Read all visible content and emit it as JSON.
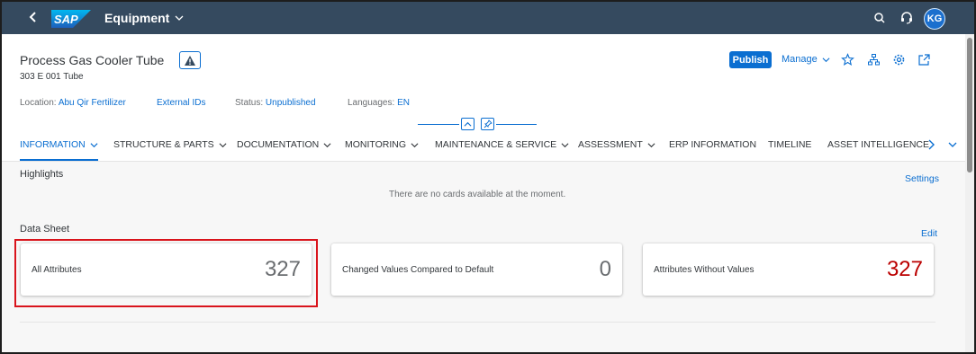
{
  "shell": {
    "app_title": "Equipment",
    "user_initials": "KG",
    "icons": [
      "back-icon",
      "sap-logo",
      "search-icon",
      "support-icon"
    ]
  },
  "header": {
    "title": "Process Gas Cooler Tube",
    "subtitle": "303 E 001 Tube",
    "publish_label": "Publish",
    "manage_label": "Manage",
    "location_label": "Location:",
    "location_value": "Abu Qir Fertilizer",
    "external_ids_label": "External IDs",
    "status_label": "Status:",
    "status_value": "Unpublished",
    "languages_label": "Languages:",
    "languages_value": "EN"
  },
  "tabs": [
    {
      "label": "INFORMATION",
      "active": true,
      "has_dropdown": true
    },
    {
      "label": "STRUCTURE & PARTS",
      "has_dropdown": true
    },
    {
      "label": "DOCUMENTATION",
      "has_dropdown": true
    },
    {
      "label": "MONITORING",
      "has_dropdown": true
    },
    {
      "label": "MAINTENANCE & SERVICE",
      "has_dropdown": true
    },
    {
      "label": "ASSESSMENT",
      "has_dropdown": true
    },
    {
      "label": "ERP INFORMATION",
      "has_dropdown": false
    },
    {
      "label": "TIMELINE",
      "has_dropdown": false
    },
    {
      "label": "ASSET INTELLIGENCE",
      "has_dropdown": false
    }
  ],
  "highlights": {
    "title": "Highlights",
    "settings_label": "Settings",
    "empty_text": "There are no cards available at the moment."
  },
  "datasheet": {
    "title": "Data Sheet",
    "edit_label": "Edit",
    "cards": [
      {
        "label": "All Attributes",
        "value": "327"
      },
      {
        "label": "Changed Values Compared to Default",
        "value": "0"
      },
      {
        "label": "Attributes Without Values",
        "value": "327"
      }
    ]
  },
  "colors": {
    "shell": "#354a5f",
    "accent": "#0a6ed1",
    "negative": "#bb0000",
    "highlight_border": "#d9141c"
  }
}
